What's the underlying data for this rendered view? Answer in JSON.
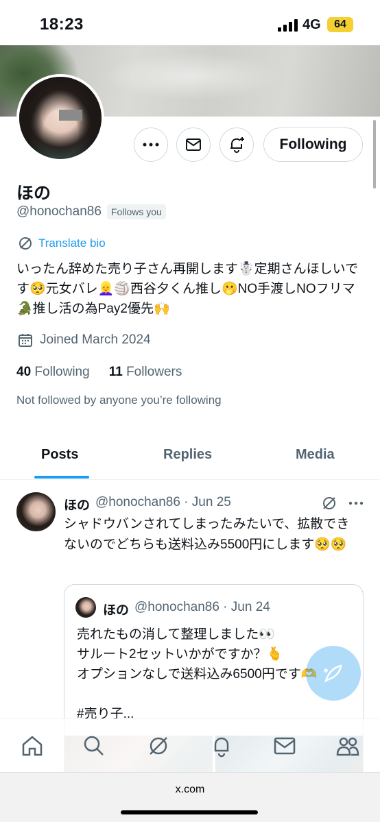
{
  "status_bar": {
    "time": "18:23",
    "network": "4G",
    "battery": "64"
  },
  "profile": {
    "name": "ほの",
    "handle": "@honochan86",
    "follows_you": "Follows you",
    "translate_bio": "Translate bio",
    "bio": "いったん辞めた売り子さん再開します☃️定期さんほしいです🥺元女バレ👱‍♀️🏐西谷夕くん推し🫢NO手渡しNOフリマ🐊推し活の為Pay2優先🙌",
    "joined": "Joined March 2024",
    "following_count": "40",
    "following_label": "Following",
    "followers_count": "11",
    "followers_label": "Followers",
    "not_followed": "Not followed by anyone you’re following",
    "following_button": "Following"
  },
  "tabs": [
    {
      "label": "Posts",
      "active": true
    },
    {
      "label": "Replies",
      "active": false
    },
    {
      "label": "Media",
      "active": false
    }
  ],
  "post": {
    "name": "ほの",
    "meta": "@honochan86 · Jun 25",
    "text": "シャドウバンされてしまったみたいで、拡散できないのでどちらも送料込み5500円にします🥺🥺",
    "quote": {
      "name": "ほの",
      "meta": "@honochan86 · Jun 24",
      "text": "売れたもの消して整理しました👀\nサルート2セットいかがですか？🫰\nオプションなしで送料込み6500円です🫶\n\n#売り子..."
    }
  },
  "url_bar": {
    "url": "x.com"
  },
  "colors": {
    "accent": "#1d9bf0",
    "text": "#0f1419",
    "secondary": "#536471",
    "border": "#cfd9de"
  },
  "icons": [
    "more-icon",
    "message-icon",
    "notification-bell-icon",
    "translate-icon",
    "calendar-icon",
    "home-icon",
    "search-icon",
    "grok-icon",
    "notifications-icon",
    "messages-icon",
    "communities-icon",
    "compose-icon"
  ]
}
